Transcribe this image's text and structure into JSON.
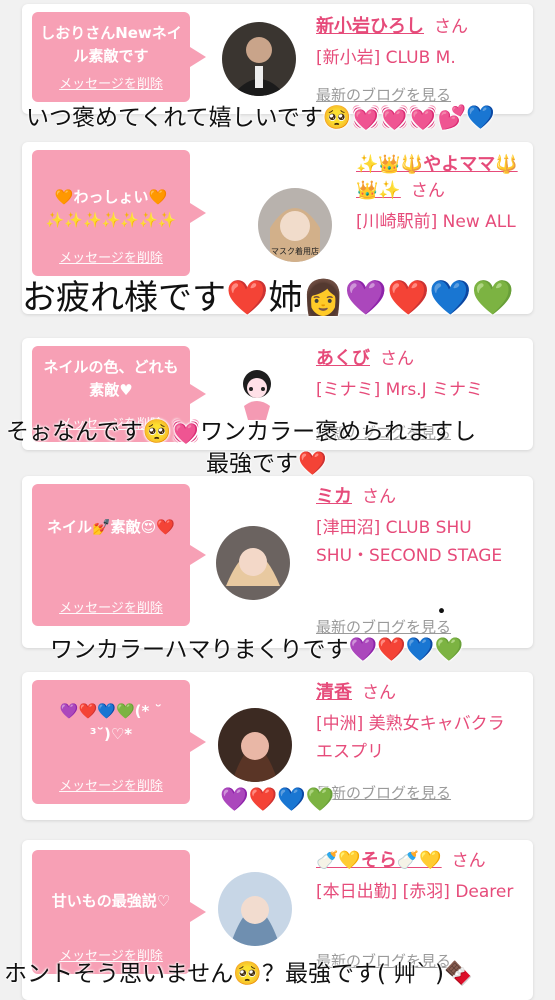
{
  "delete_label": "メッセージを削除",
  "blog_label": "最新のブログを見る",
  "san_label": "さん",
  "accent_color": "#e64b7a",
  "bubble_color": "#f7a0b5",
  "cards": [
    {
      "message": "しおりさんNewネイル素敵です",
      "name": "新小岩ひろし",
      "shop": "[新小岩] CLUB M."
    },
    {
      "message": "🧡わっしょい🧡 ✨✨✨✨✨✨✨",
      "name": "✨👑🔱やよママ🔱👑✨",
      "shop": "[川崎駅前] New ALL"
    },
    {
      "message": "ネイルの色、どれも素敵♥",
      "name": "あくび",
      "shop": "[ミナミ] Mrs.J ミナミ"
    },
    {
      "message": "ネイル💅素敵😍❤️",
      "name": "ミカ",
      "shop": "[津田沼] CLUB SHU SHU・SECOND STAGE"
    },
    {
      "message": "💜❤️💙💚(* ˘ ³˘)♡*",
      "name": "清香",
      "shop": "[中洲] 美熟女キャバクラ エスプリ"
    },
    {
      "message": "甘いもの最強説♡",
      "name": "🍼💛そら🍼💛",
      "shop": "[本日出勤] [赤羽] Dearer"
    }
  ],
  "overlays": [
    {
      "text": "いつ褒めてくれて嬉しいです🥺💓💓💓💕💙"
    },
    {
      "text": "お疲れ様です❤️姉👩💜❤️💙💚"
    },
    {
      "text": "そぉなんです🥺💓ワンカラー褒められますし"
    },
    {
      "text": "最強です❤️"
    },
    {
      "text": "・"
    },
    {
      "text": "ワンカラーハマりまくりです💜❤️💙💚"
    },
    {
      "text": "💜❤️💙💚"
    },
    {
      "text": "ホントそう思いません🥺？最強です( 艸ˋ )🍫"
    }
  ],
  "avatars": [
    "man-in-suit",
    "woman-blonde-masked",
    "cartoon-character",
    "woman-light-hair",
    "woman-dark-hair",
    "woman-blue-hair"
  ],
  "avatar_label_2": "マスク着用店"
}
